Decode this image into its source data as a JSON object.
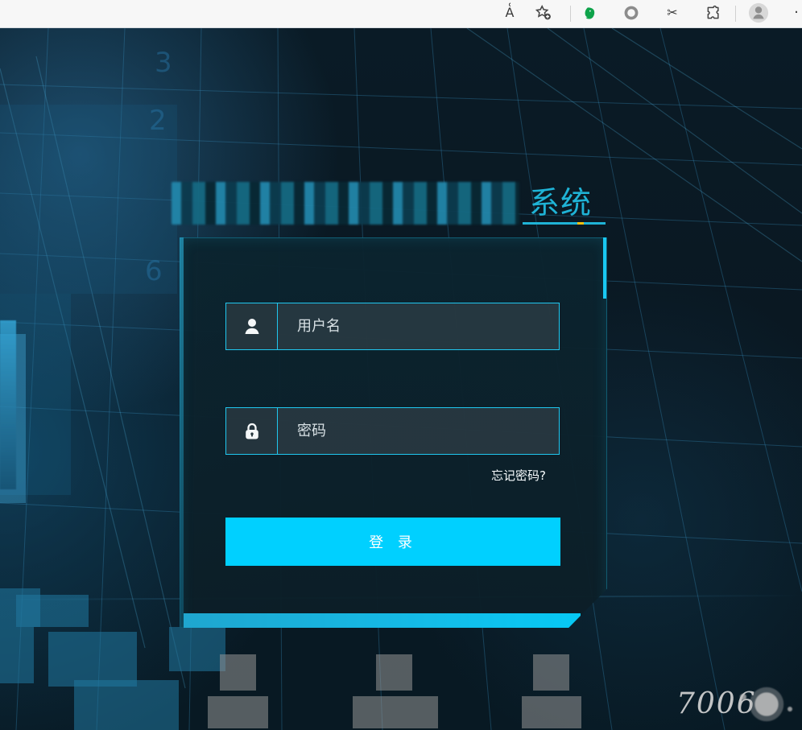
{
  "browser": {
    "toolbar_icons": [
      "read-aloud-icon",
      "add-favorite-icon",
      "evernote-icon",
      "extension-circle-icon",
      "clipboard-cut-icon",
      "puzzle-icon",
      "profile-icon"
    ],
    "read_aloud_glyph": "A͑",
    "cut_glyph": "✂",
    "puzzle_glyph": "⧉",
    "profile_glyph": "●"
  },
  "login": {
    "title_suffix": "系统",
    "username_placeholder": "用户名",
    "password_placeholder": "密码",
    "forgot_password": "忘记密码?",
    "login_button": "登 录"
  },
  "footer": {
    "watermark_text": "7006"
  },
  "colors": {
    "accent": "#1fb3d6",
    "button": "#00d0ff",
    "border": "#20c7ef",
    "background": "#07131c"
  }
}
